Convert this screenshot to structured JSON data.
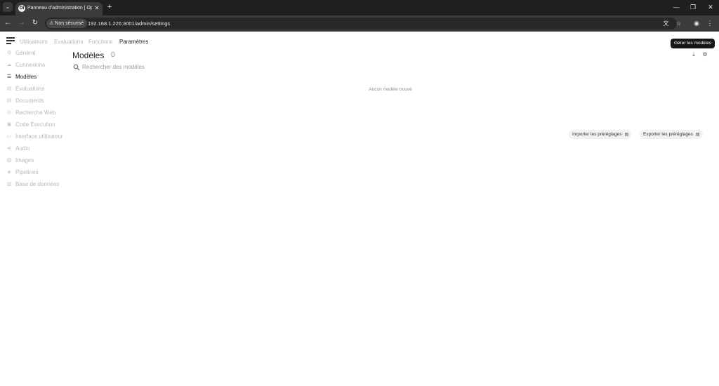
{
  "browser": {
    "tab_title": "Panneau d'administration | Op",
    "tab_favicon": "OI",
    "security_label": "Non sécurisé",
    "url": "192.168.1.226:3001/admin/settings"
  },
  "icons": {
    "tab_list": "⌄",
    "close": "✕",
    "new_tab": "+",
    "minimize": "—",
    "restore": "❐",
    "window_close": "✕",
    "back": "←",
    "forward": "→",
    "reload": "↻",
    "warning": "⚠",
    "translate": "文",
    "bookmark": "☆",
    "profile": "◉",
    "more": "⋮",
    "download": "⤓",
    "settings": "⚙",
    "file": "▤"
  },
  "top_nav": {
    "items": [
      {
        "label": "Utilisateurs"
      },
      {
        "label": "Évaluations"
      },
      {
        "label": "Fonctions"
      },
      {
        "label": "Paramètres",
        "active": true
      }
    ]
  },
  "sidebar": {
    "items": [
      {
        "label": "Général",
        "icon": "⚙"
      },
      {
        "label": "Connexions",
        "icon": "☁"
      },
      {
        "label": "Modèles",
        "icon": "☰",
        "active": true
      },
      {
        "label": "Évaluations",
        "icon": "▤"
      },
      {
        "label": "Documents",
        "icon": "▤"
      },
      {
        "label": "Recherche Web",
        "icon": "◎"
      },
      {
        "label": "Code Execution",
        "icon": "▣"
      },
      {
        "label": "Interface utilisateur",
        "icon": "▭"
      },
      {
        "label": "Audio",
        "icon": "◂)"
      },
      {
        "label": "Images",
        "icon": "▨"
      },
      {
        "label": "Pipelines",
        "icon": "◈"
      },
      {
        "label": "Base de données",
        "icon": "▥"
      }
    ]
  },
  "main": {
    "title": "Modèles",
    "count": "0",
    "search_placeholder": "Rechercher des modèles",
    "empty_message": "Aucun modèle trouvé",
    "tooltip": "Gérer les modèles",
    "import_label": "Importer les préréglages",
    "export_label": "Exporter les préréglages"
  }
}
